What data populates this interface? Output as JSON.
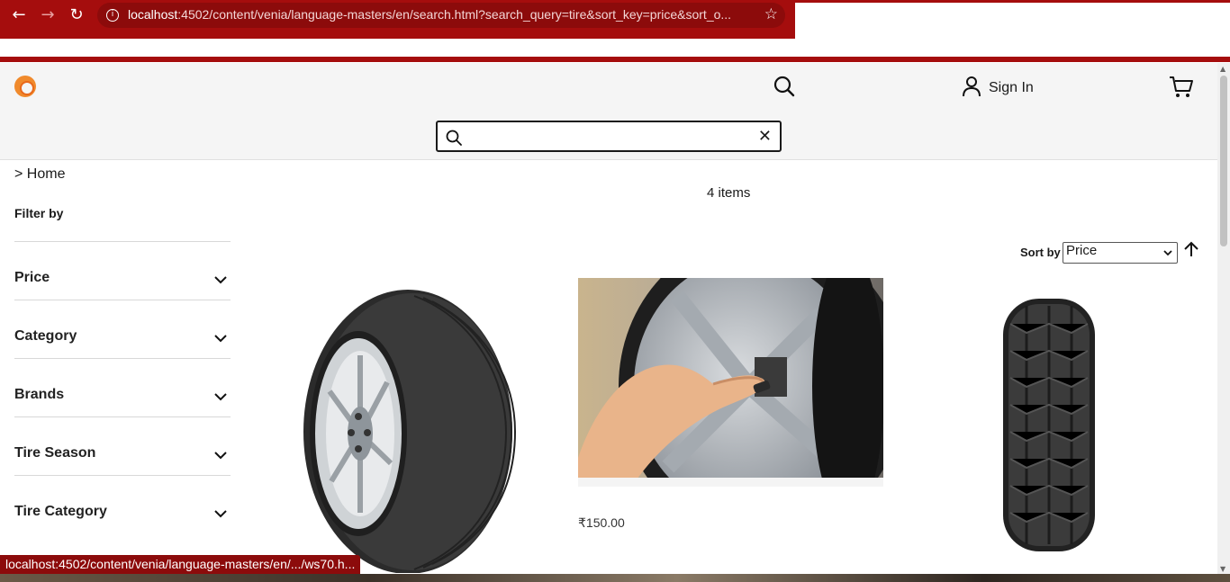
{
  "browser": {
    "url_host": "localhost",
    "url_rest": ":4502/content/venia/language-masters/en/search.html?search_query=tire&sort_key=price&sort_o...",
    "status_url": "localhost:4502/content/venia/language-masters/en/.../ws70.h..."
  },
  "header": {
    "signin_label": "Sign In",
    "search_value": ""
  },
  "sidebar": {
    "breadcrumb": "> Home",
    "filter_title": "Filter by",
    "filters": [
      {
        "label": "Price"
      },
      {
        "label": "Category"
      },
      {
        "label": "Brands"
      },
      {
        "label": "Tire Season"
      },
      {
        "label": "Tire Category"
      }
    ]
  },
  "results": {
    "count_label": "4 items",
    "sort_label": "Sort by",
    "sort_value": "Price",
    "products": [
      {
        "image": "chrome-rim-tire",
        "price": ""
      },
      {
        "image": "tire-valve-check",
        "price": "₹150.00"
      },
      {
        "image": "winter-tire",
        "price": ""
      }
    ]
  },
  "colors": {
    "browser_accent": "#a50d0d",
    "header_bg": "#f5f5f5",
    "logo": "#f08a2c"
  }
}
